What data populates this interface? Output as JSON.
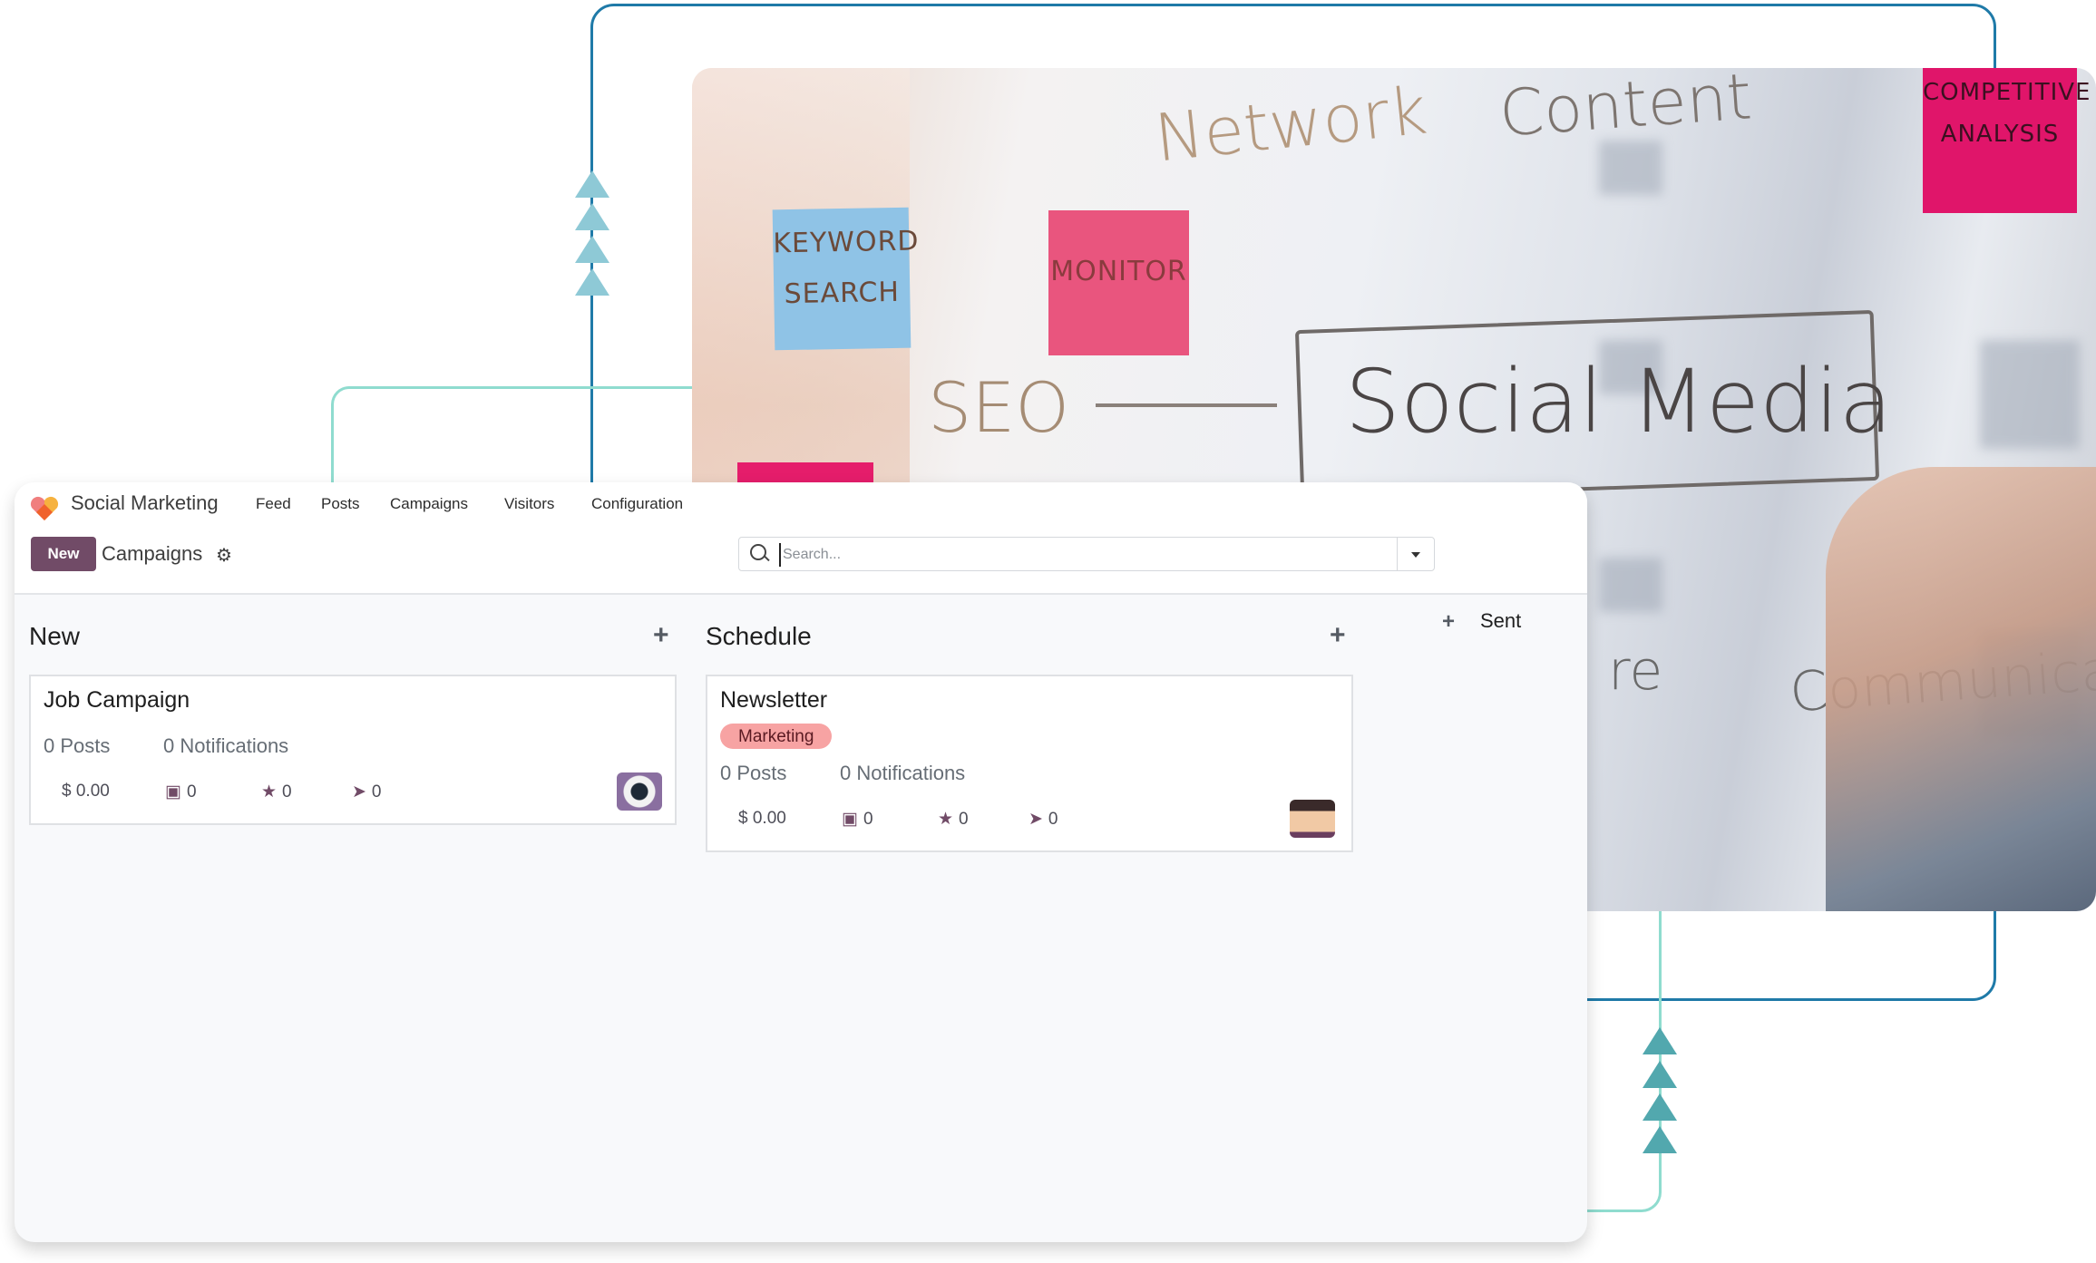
{
  "app": {
    "name": "Social Marketing",
    "menu": [
      "Feed",
      "Posts",
      "Campaigns",
      "Visitors",
      "Configuration"
    ]
  },
  "control_panel": {
    "new_button": "New",
    "breadcrumb": "Campaigns",
    "search_placeholder": "Search..."
  },
  "columns": [
    {
      "title": "New",
      "cards": [
        {
          "title": "Job Campaign",
          "tags": [],
          "posts": "0 Posts",
          "notifications": "0 Notifications",
          "cost": "$ 0.00",
          "revenue": "0",
          "rating": "0",
          "clicks": "0",
          "avatar": "robot-avatar"
        }
      ]
    },
    {
      "title": "Schedule",
      "cards": [
        {
          "title": "Newsletter",
          "tags": [
            "Marketing"
          ],
          "posts": "0 Posts",
          "notifications": "0 Notifications",
          "cost": "$ 0.00",
          "revenue": "0",
          "rating": "0",
          "clicks": "0",
          "avatar": "user-avatar"
        }
      ]
    },
    {
      "title": "Sent",
      "folded": true,
      "cards": []
    }
  ],
  "background_photo": {
    "texts": [
      "Network",
      "Content",
      "KEYWORD SEARCH",
      "MONITOR",
      "SEO",
      "Social Media",
      "COMPETITIVE ANALYSIS",
      "re",
      "Communicate"
    ]
  },
  "colors": {
    "brand": "#714b67",
    "tag_marketing": "#f7a3a3",
    "connector_blue": "#1f7aa8",
    "connector_teal": "#8fdccf"
  }
}
